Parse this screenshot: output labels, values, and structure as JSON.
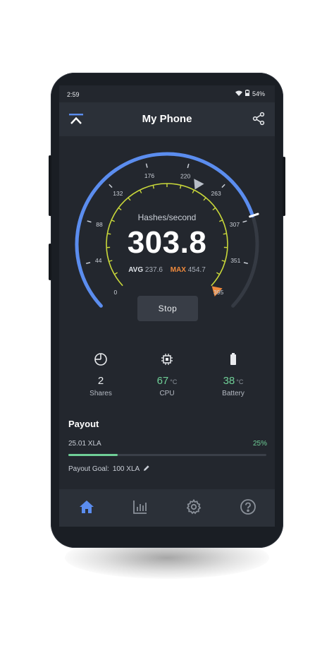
{
  "status": {
    "time": "2:59",
    "battery": "54%"
  },
  "app": {
    "title": "My Phone"
  },
  "gauge": {
    "ticks": [
      "0",
      "44",
      "88",
      "132",
      "176",
      "220",
      "263",
      "307",
      "351",
      "395"
    ],
    "max_scale": 395,
    "current": 303.8,
    "avg_value": 237.6,
    "max_value": 454.7
  },
  "hashrate": {
    "label": "Hashes/second",
    "value": "303.8",
    "avg_label": "AVG",
    "avg": "237.6",
    "max_label": "MAX",
    "max": "454.7"
  },
  "controls": {
    "stop_label": "Stop"
  },
  "stats": {
    "shares": {
      "value": "2",
      "label": "Shares"
    },
    "cpu": {
      "value": "67",
      "unit": "°C",
      "label": "CPU"
    },
    "battery": {
      "value": "38",
      "unit": "°C",
      "label": "Battery"
    }
  },
  "payout": {
    "title": "Payout",
    "amount": "25.01 XLA",
    "percent": "25%",
    "progress": 0.25,
    "goal_label": "Payout Goal:",
    "goal_value": "100 XLA"
  },
  "nav": {
    "active": "home"
  },
  "colors": {
    "accent_blue": "#5b8def",
    "gauge_yellow": "#c9d83a",
    "avg_marker": "#b9bfc8",
    "max_marker": "#f08a3c",
    "green": "#6fcf97"
  }
}
